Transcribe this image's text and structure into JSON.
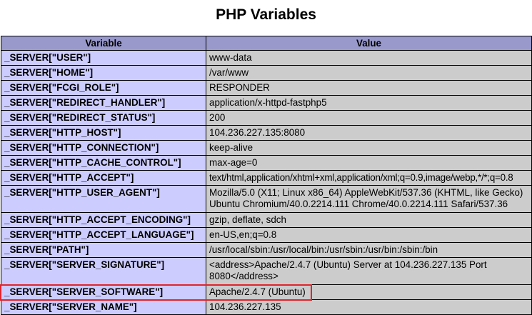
{
  "page": {
    "title": "PHP Variables"
  },
  "table": {
    "header": {
      "variable": "Variable",
      "value": "Value"
    },
    "rows": [
      {
        "variable": "_SERVER[\"USER\"]",
        "value": "www-data"
      },
      {
        "variable": "_SERVER[\"HOME\"]",
        "value": "/var/www"
      },
      {
        "variable": "_SERVER[\"FCGI_ROLE\"]",
        "value": "RESPONDER"
      },
      {
        "variable": "_SERVER[\"REDIRECT_HANDLER\"]",
        "value": "application/x-httpd-fastphp5"
      },
      {
        "variable": "_SERVER[\"REDIRECT_STATUS\"]",
        "value": "200"
      },
      {
        "variable": "_SERVER[\"HTTP_HOST\"]",
        "value": "104.236.227.135:8080"
      },
      {
        "variable": "_SERVER[\"HTTP_CONNECTION\"]",
        "value": "keep-alive"
      },
      {
        "variable": "_SERVER[\"HTTP_CACHE_CONTROL\"]",
        "value": "max-age=0"
      },
      {
        "variable": "_SERVER[\"HTTP_ACCEPT\"]",
        "value": "text/html,application/xhtml+xml,application/xml;q=0.9,image/webp,*/*;q=0.8"
      },
      {
        "variable": "_SERVER[\"HTTP_USER_AGENT\"]",
        "value": "Mozilla/5.0 (X11; Linux x86_64) AppleWebKit/537.36 (KHTML, like Gecko) Ubuntu Chromium/40.0.2214.111 Chrome/40.0.2214.111 Safari/537.36"
      },
      {
        "variable": "_SERVER[\"HTTP_ACCEPT_ENCODING\"]",
        "value": "gzip, deflate, sdch"
      },
      {
        "variable": "_SERVER[\"HTTP_ACCEPT_LANGUAGE\"]",
        "value": "en-US,en;q=0.8"
      },
      {
        "variable": "_SERVER[\"PATH\"]",
        "value": "/usr/local/sbin:/usr/local/bin:/usr/sbin:/usr/bin:/sbin:/bin"
      },
      {
        "variable": "_SERVER[\"SERVER_SIGNATURE\"]",
        "value": "<address>Apache/2.4.7 (Ubuntu) Server at 104.236.227.135 Port 8080</address>"
      },
      {
        "variable": "_SERVER[\"SERVER_SOFTWARE\"]",
        "value": "Apache/2.4.7 (Ubuntu)"
      },
      {
        "variable": "_SERVER[\"SERVER_NAME\"]",
        "value": "104.236.227.135"
      }
    ]
  },
  "colors": {
    "header_bg": "#9999cc",
    "variable_bg": "#ccccff",
    "value_bg": "#cccccc",
    "highlight": "#e0242c"
  }
}
